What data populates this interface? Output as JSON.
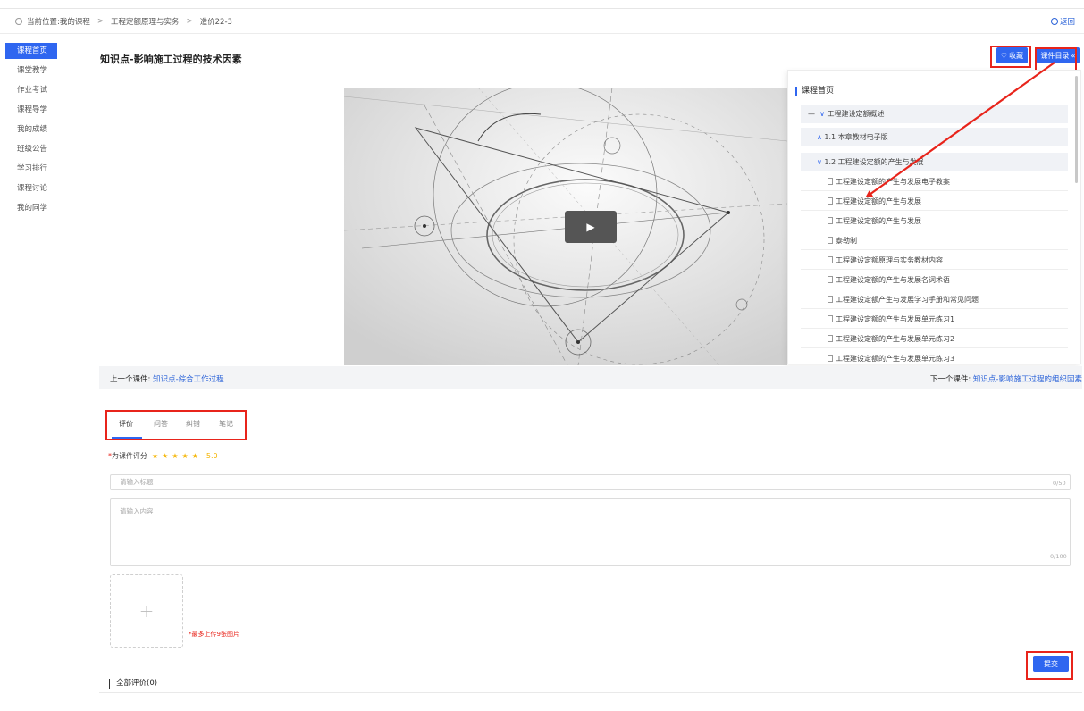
{
  "breadcrumb": {
    "items": [
      "当前位置:我的课程",
      "工程定额原理与实务",
      "造价22-3"
    ],
    "back_label": "返回"
  },
  "sidebar": {
    "items": [
      {
        "label": "课程首页",
        "active": true
      },
      {
        "label": "课堂教学"
      },
      {
        "label": "作业考试"
      },
      {
        "label": "课程导学"
      },
      {
        "label": "我的成绩"
      },
      {
        "label": "班级公告"
      },
      {
        "label": "学习排行"
      },
      {
        "label": "课程讨论"
      },
      {
        "label": "我的同学"
      }
    ]
  },
  "page_title": "知识点-影响施工过程的技术因素",
  "actions": {
    "favorite_label": "收藏",
    "catalog_label": "课件目录"
  },
  "catalog": {
    "home": "课程首页",
    "chapter": "工程建设定额概述",
    "sections": [
      "1.1 本章教材电子版",
      "1.2 工程建设定额的产生与发展"
    ],
    "leaves": [
      "工程建设定额的产生与发展电子教案",
      "工程建设定额的产生与发展",
      "工程建设定额的产生与发展",
      "泰勒制",
      "工程建设定额原理与实务教材内容",
      "工程建设定额的产生与发展名词术语",
      "工程建设定额产生与发展学习手册和常见问题",
      "工程建设定额的产生与发展单元练习1",
      "工程建设定额的产生与发展单元练习2",
      "工程建设定额的产生与发展单元练习3"
    ]
  },
  "nav": {
    "prev_label": "上一个课件:",
    "prev_link": "知识点-综合工作过程",
    "next_label": "下一个课件:",
    "next_link": "知识点-影响施工过程的组织因素"
  },
  "tabs": [
    "评价",
    "问答",
    "纠错",
    "笔记"
  ],
  "review": {
    "rating_label": "为课件评分",
    "stars": 5,
    "score": "5.0",
    "title_placeholder": "请输入标题",
    "title_count": "0/50",
    "content_placeholder": "请输入内容",
    "content_count": "0/100",
    "upload_hint": "*最多上传9张图片",
    "submit_label": "提交",
    "all_reviews": "全部评价(0)"
  },
  "colors": {
    "accent": "#2f66f0",
    "annotation": "#e8241b",
    "star": "#f5b400"
  }
}
